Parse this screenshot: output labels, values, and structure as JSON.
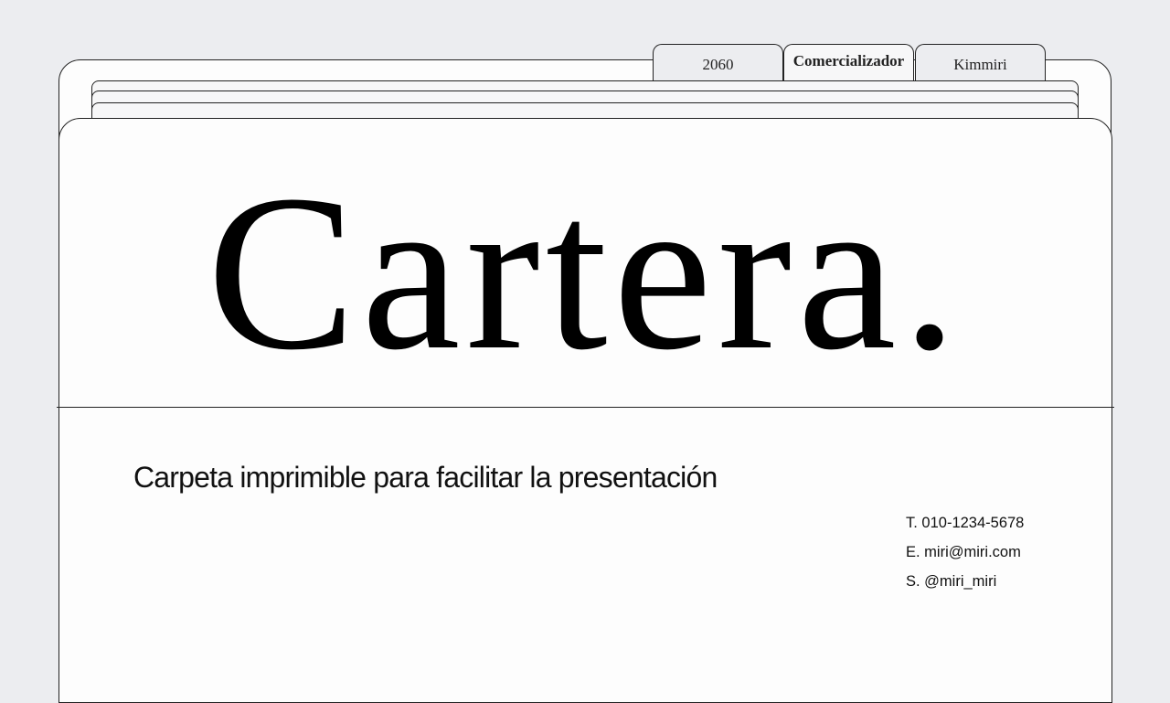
{
  "tabs": [
    {
      "label": "2060",
      "active": false
    },
    {
      "label": "Comercializador",
      "active": true
    },
    {
      "label": "Kimmiri",
      "active": false
    }
  ],
  "cover": {
    "title": "Cartera.",
    "subtitle": "Carpeta imprimible para facilitar la presentación"
  },
  "contact": {
    "phone": "T. 010-1234-5678",
    "email": "E. miri@miri.com",
    "social": "S. @miri_miri"
  },
  "colors": {
    "background": "#ecedf0",
    "paper": "#fdfdfd",
    "outline": "#222222",
    "text": "#000000"
  }
}
